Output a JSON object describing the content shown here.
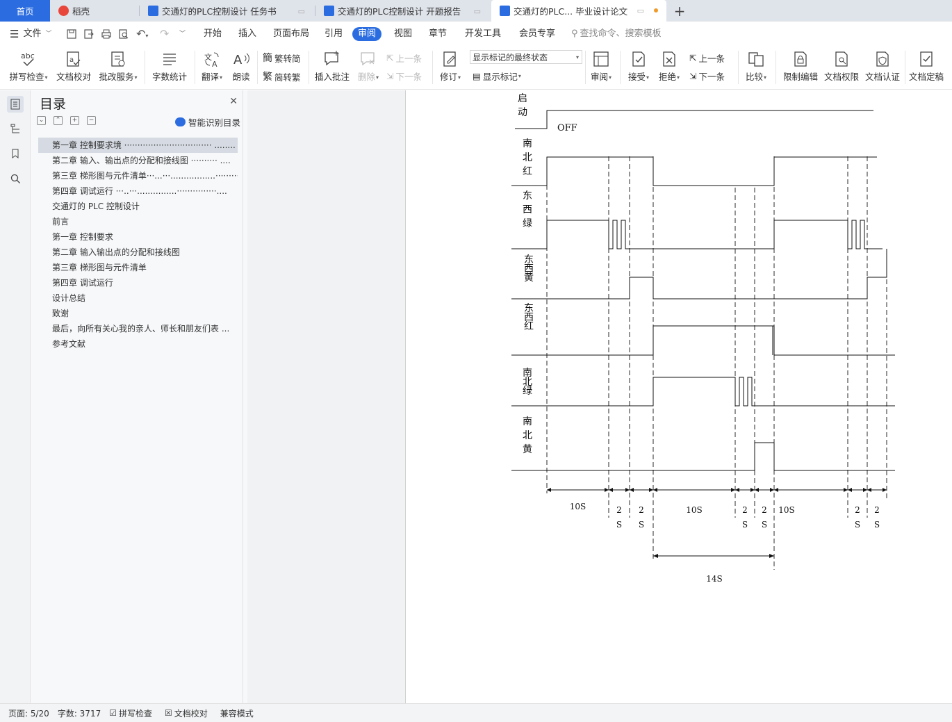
{
  "tabs": [
    {
      "label": "首页",
      "active": false,
      "home": true
    },
    {
      "label": "稻壳",
      "active": false
    },
    {
      "label": "交通灯的PLC控制设计 任务书",
      "active": false
    },
    {
      "label": "交通灯的PLC控制设计 开题报告",
      "active": false
    },
    {
      "label": "交通灯的PLC... 毕业设计论文",
      "active": true
    }
  ],
  "new_tab": "+",
  "menu": {
    "file": "文件",
    "items": [
      "开始",
      "插入",
      "页面布局",
      "引用",
      "审阅",
      "视图",
      "章节",
      "开发工具",
      "会员专享"
    ],
    "active": "审阅",
    "search_placeholder": "查找命令、搜索模板"
  },
  "ribbon": {
    "spell": "拼写检查",
    "proof": "文档校对",
    "review_service": "批改服务",
    "word_count": "字数统计",
    "translate": "翻译",
    "read": "朗读",
    "trad_simp": "繁转简",
    "simp_trad": "简转繁",
    "insert_comment": "插入批注",
    "delete": "删除",
    "prev_comment": "上一条",
    "next_comment": "下一条",
    "track": "修订",
    "markup_state": "显示标记的最终状态",
    "show_markup": "显示标记",
    "review_pane": "审阅",
    "accept": "接受",
    "reject": "拒绝",
    "prev_change": "上一条",
    "next_change": "下一条",
    "compare": "比较",
    "restrict": "限制编辑",
    "doc_rights": "文档权限",
    "doc_cert": "文档认证",
    "doc_final": "文档定稿"
  },
  "toc": {
    "title": "目录",
    "smart": "智能识别目录",
    "items": [
      {
        "label": "第一章  控制要求境  ································· ........",
        "selected": true
      },
      {
        "label": "第二章  输入、输出点的分配和接线图  ·········· ....",
        "selected": false
      },
      {
        "label": "第三章  梯形图与元件清单···...···.................···········....",
        "selected": false
      },
      {
        "label": "第四章  调试运行    ···..···...............···············....",
        "selected": false
      },
      {
        "label": "交通灯的 PLC 控制设计",
        "selected": false
      },
      {
        "label": "前言",
        "selected": false
      },
      {
        "label": "第一章  控制要求",
        "selected": false
      },
      {
        "label": "第二章  输入输出点的分配和接线图",
        "selected": false
      },
      {
        "label": "第三章  梯形图与元件清单",
        "selected": false
      },
      {
        "label": "第四章  调试运行",
        "selected": false
      },
      {
        "label": "设计总结",
        "selected": false
      },
      {
        "label": "致谢",
        "selected": false
      },
      {
        "label": "最后，向所有关心我的亲人、师长和朋友们表 ...",
        "selected": false
      },
      {
        "label": "参考文献",
        "selected": false
      }
    ]
  },
  "diagram": {
    "rows": [
      {
        "label": "启\n动",
        "note": "OFF"
      },
      {
        "label": "南\n北\n红"
      },
      {
        "label": "东\n西\n绿"
      },
      {
        "label": "东\n西\n黄"
      },
      {
        "label": "东\n西\n红"
      },
      {
        "label": "南\n北\n绿"
      },
      {
        "label": "南\n北\n黄"
      }
    ],
    "durations": [
      "10S",
      "2\nS",
      "2\nS",
      "10S",
      "2\nS",
      "2\nS",
      "10S",
      "2\nS",
      "2\nS"
    ],
    "span_label": "14S"
  },
  "status": {
    "page": "页面: 5/20",
    "words": "字数: 3717",
    "spell": "拼写检查",
    "proof": "文档校对",
    "compat": "兼容模式"
  },
  "colors": {
    "accent": "#2b6de0",
    "wps_red": "#e8463a",
    "word_blue": "#2b6de0",
    "active_tab_bg": "#ffffff",
    "tabbar_bg": "#dfe3ea"
  }
}
